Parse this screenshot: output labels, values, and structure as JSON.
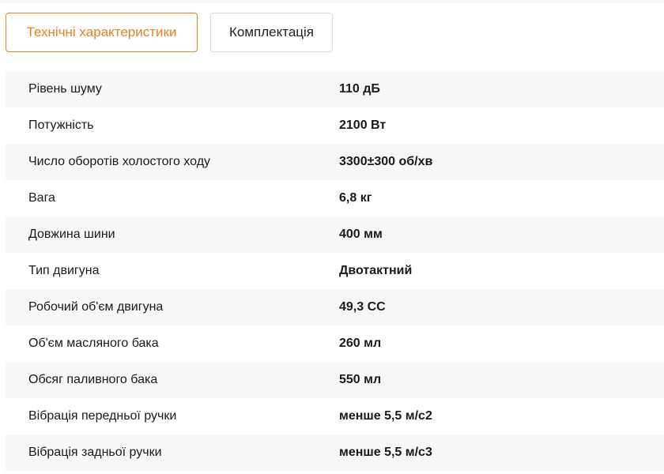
{
  "tabs": [
    {
      "label": "Технічні характеристики",
      "active": true
    },
    {
      "label": "Комплектація",
      "active": false
    }
  ],
  "colors": {
    "accent": "#e8821e",
    "row_stripe": "#f7f7f7"
  },
  "specs": [
    {
      "label": "Рівень шуму",
      "value": "110 дБ"
    },
    {
      "label": "Потужність",
      "value": "2100 Вт"
    },
    {
      "label": "Число оборотів холостого ходу",
      "value": "3300±300 об/хв"
    },
    {
      "label": "Вага",
      "value": "6,8 кг"
    },
    {
      "label": "Довжина шини",
      "value": "400 мм"
    },
    {
      "label": "Тип двигуна",
      "value": "Двотактний"
    },
    {
      "label": "Робочий об'єм двигуна",
      "value": "49,3 СС"
    },
    {
      "label": "Об'єм масляного бака",
      "value": "260 мл"
    },
    {
      "label": "Обсяг паливного бака",
      "value": "550 мл"
    },
    {
      "label": "Вібрація передньої ручки",
      "value": "менше 5,5 м/с2"
    },
    {
      "label": "Вібрація задньої ручки",
      "value": "менше 5,5 м/с3"
    }
  ]
}
